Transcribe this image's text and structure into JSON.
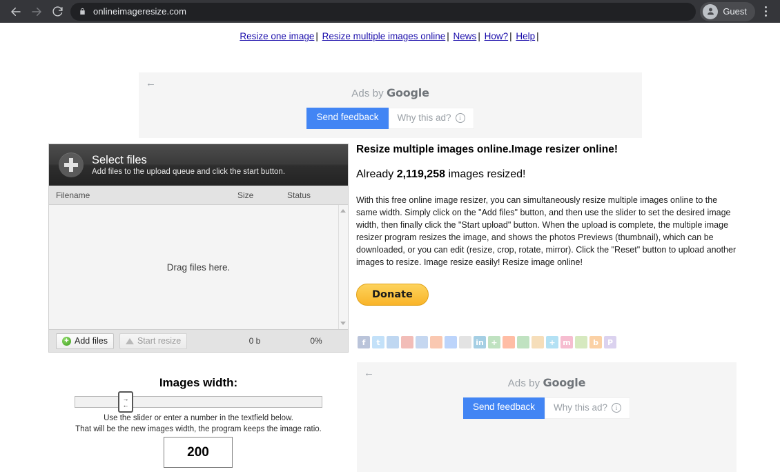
{
  "browser": {
    "back_icon": "back-arrow-icon",
    "forward_icon": "forward-arrow-icon",
    "reload_icon": "reload-icon",
    "lock_icon": "lock-icon",
    "url": "onlineimageresize.com",
    "profile_name": "Guest",
    "avatar_icon": "person-avatar-icon",
    "menu_icon": "three-dot-menu-icon"
  },
  "topnav": {
    "links": [
      "Resize one image",
      "Resize multiple images online",
      "News",
      "How?",
      "Help"
    ],
    "separator": "|"
  },
  "ads": {
    "back_arrow": "←",
    "label_prefix": "Ads by",
    "label_brand": "Google",
    "send_feedback": "Send feedback",
    "why_this_ad": "Why this ad?",
    "info_glyph": "i",
    "accent_color": "#4285f4"
  },
  "uploader": {
    "title": "Select files",
    "subtitle": "Add files to the upload queue and click the start button.",
    "plus_icon": "plus-icon",
    "columns": {
      "filename": "Filename",
      "size": "Size",
      "status": "Status"
    },
    "dropzone_text": "Drag files here.",
    "add_files_label": "Add files",
    "start_resize_label": "Start resize",
    "total_size": "0 b",
    "progress_pct": "0%"
  },
  "slider": {
    "title": "Images width:",
    "handle_icon": "left-right-arrows-icon",
    "handle_glyph_top": "→",
    "handle_glyph_bottom": "←",
    "hint_line1": "Use the slider or enter a number in the textfield below.",
    "hint_line2": "That will be the new images width, the program keeps the image ratio.",
    "width_value": "200"
  },
  "content": {
    "heading": "Resize multiple images online.Image resizer online!",
    "count_prefix": "Already",
    "count_value": "2,119,258",
    "count_suffix": "images resized!",
    "paragraph": "With this free online image resizer, you can simultaneously resize multiple images online to the same width. Simply click on the \"Add files\" button, and then use the slider to set the desired image width, then finally click the \"Start upload\" button. When the upload is complete, the multiple image resizer program resizes the image, and shows the photos Previews (thumbnail), which can be downloaded, or you can edit (resize, crop, rotate, mirror). Click the \"Reset\" button to upload another images to resize. Image resize easily! Resize image online!",
    "donate_label": "Donate",
    "donate_color": "#f9b429"
  },
  "socials": [
    {
      "name": "facebook-icon",
      "glyph": "f",
      "color": "#3b5998"
    },
    {
      "name": "twitter-icon",
      "glyph": "t",
      "color": "#55acee"
    },
    {
      "name": "windows-icon",
      "glyph": "",
      "color": "#4a90d9"
    },
    {
      "name": "google-icon",
      "glyph": "",
      "color": "#db4437"
    },
    {
      "name": "blue-share-icon",
      "glyph": "",
      "color": "#5b8ed6"
    },
    {
      "name": "rss-icon",
      "glyph": "",
      "color": "#f26522"
    },
    {
      "name": "google-plus-icon",
      "glyph": "",
      "color": "#4285f4"
    },
    {
      "name": "grey-share-icon",
      "glyph": "",
      "color": "#b0b0b0"
    },
    {
      "name": "linkedin-icon",
      "glyph": "in",
      "color": "#0077b5"
    },
    {
      "name": "add-green-icon",
      "glyph": "+",
      "color": "#4caf50"
    },
    {
      "name": "reddit-icon",
      "glyph": "",
      "color": "#ff4500"
    },
    {
      "name": "chat-green-icon",
      "glyph": "",
      "color": "#4caf50"
    },
    {
      "name": "person-icon",
      "glyph": "",
      "color": "#e8a33d"
    },
    {
      "name": "add-blue-icon",
      "glyph": "+",
      "color": "#29abe2"
    },
    {
      "name": "mixx-icon",
      "glyph": "m",
      "color": "#e8467c"
    },
    {
      "name": "share-multi-icon",
      "glyph": "",
      "color": "#8bc34a"
    },
    {
      "name": "blogger-icon",
      "glyph": "b",
      "color": "#f57d00"
    },
    {
      "name": "pinterest-icon",
      "glyph": "P",
      "color": "#9b7fd4"
    }
  ]
}
